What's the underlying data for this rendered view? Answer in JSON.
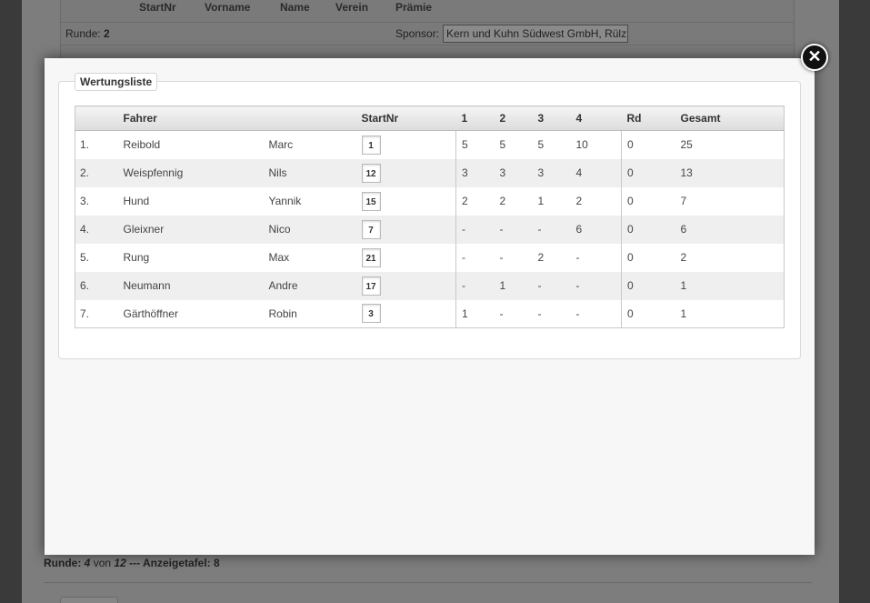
{
  "background": {
    "headers": [
      "StartNr",
      "Vorname",
      "Name",
      "Verein",
      "Prämie"
    ],
    "runde_label": "Runde:",
    "runde_value": "2",
    "sponsor_label": "Sponsor:",
    "sponsor_value": "Kern und Kuhn Südwest GmbH, Rülz",
    "footer_runde": "Runde:",
    "footer_current": "4",
    "footer_von": "von",
    "footer_total": "12",
    "footer_rest": "--- Anzeigetafel: 8"
  },
  "modal": {
    "close_symbol": "✕",
    "legend": "Wertungsliste",
    "columns": {
      "rank": "",
      "fahrer": "Fahrer",
      "vorname": "",
      "startnr": "StartNr",
      "r1": "1",
      "r2": "2",
      "r3": "3",
      "r4": "4",
      "rd": "Rd",
      "gesamt": "Gesamt"
    },
    "rows": [
      {
        "rank": "1.",
        "name": "Reibold",
        "vorname": "Marc",
        "startnr": "1",
        "r1": "5",
        "r2": "5",
        "r3": "5",
        "r4": "10",
        "rd": "0",
        "gesamt": "25"
      },
      {
        "rank": "2.",
        "name": "Weispfennig",
        "vorname": "Nils",
        "startnr": "12",
        "r1": "3",
        "r2": "3",
        "r3": "3",
        "r4": "4",
        "rd": "0",
        "gesamt": "13"
      },
      {
        "rank": "3.",
        "name": "Hund",
        "vorname": "Yannik",
        "startnr": "15",
        "r1": "2",
        "r2": "2",
        "r3": "1",
        "r4": "2",
        "rd": "0",
        "gesamt": "7"
      },
      {
        "rank": "4.",
        "name": "Gleixner",
        "vorname": "Nico",
        "startnr": "7",
        "r1": "-",
        "r2": "-",
        "r3": "-",
        "r4": "6",
        "rd": "0",
        "gesamt": "6"
      },
      {
        "rank": "5.",
        "name": "Rung",
        "vorname": "Max",
        "startnr": "21",
        "r1": "-",
        "r2": "-",
        "r3": "2",
        "r4": "-",
        "rd": "0",
        "gesamt": "2"
      },
      {
        "rank": "6.",
        "name": "Neumann",
        "vorname": "Andre",
        "startnr": "17",
        "r1": "-",
        "r2": "1",
        "r3": "-",
        "r4": "-",
        "rd": "0",
        "gesamt": "1"
      },
      {
        "rank": "7.",
        "name": "Gärthöffner",
        "vorname": "Robin",
        "startnr": "3",
        "r1": "1",
        "r2": "-",
        "r3": "-",
        "r4": "-",
        "rd": "0",
        "gesamt": "1"
      }
    ]
  }
}
